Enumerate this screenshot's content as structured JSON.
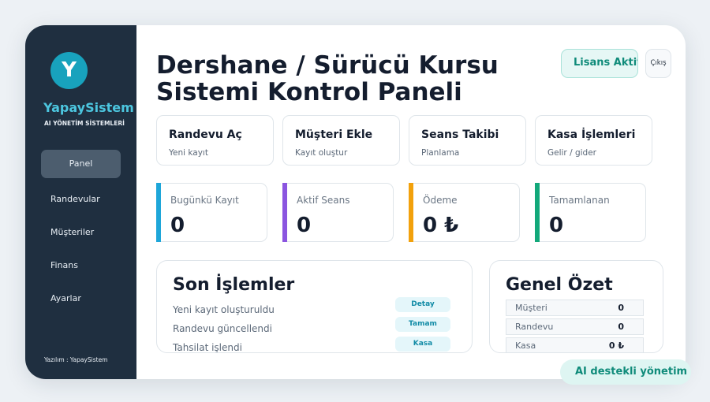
{
  "brand": {
    "logo_letter": "Y",
    "name": "YapaySistem",
    "subtitle": "AI YÖNETİM SİSTEMLERİ"
  },
  "sidebar": {
    "items": [
      {
        "label": "Panel",
        "active": true
      },
      {
        "label": "Randevular",
        "active": false
      },
      {
        "label": "Müşteriler",
        "active": false
      },
      {
        "label": "Finans",
        "active": false
      },
      {
        "label": "Ayarlar",
        "active": false
      }
    ],
    "footer": "Yazılım : YapaySistem"
  },
  "header": {
    "title_line1": "Dershane / Sürücü Kursu",
    "title_line2": "Sistemi Kontrol Paneli",
    "license_label": "Lisans Aktif",
    "logout_label": "Çıkış"
  },
  "quick_actions": [
    {
      "title": "Randevu Aç",
      "subtitle": "Yeni kayıt"
    },
    {
      "title": "Müşteri Ekle",
      "subtitle": "Kayıt oluştur"
    },
    {
      "title": "Seans Takibi",
      "subtitle": "Planlama"
    },
    {
      "title": "Kasa İşlemleri",
      "subtitle": "Gelir / gider"
    }
  ],
  "stats": [
    {
      "label": "Bugünkü Kayıt",
      "value": "0",
      "color": "#1ea6d9"
    },
    {
      "label": "Aktif Seans",
      "value": "0",
      "color": "#8b55e0"
    },
    {
      "label": "Ödeme",
      "value": "0 ₺",
      "color": "#f2a10c"
    },
    {
      "label": "Tamamlanan",
      "value": "0",
      "color": "#12a87a"
    }
  ],
  "recent": {
    "title": "Son İşlemler",
    "items": [
      {
        "text": "Yeni kayıt oluşturuldu",
        "badge": "Detay"
      },
      {
        "text": "Randevu güncellendi",
        "badge": "Tamam"
      },
      {
        "text": "Tahsilat işlendi",
        "badge": "Kasa"
      }
    ]
  },
  "summary": {
    "title": "Genel Özet",
    "rows": [
      {
        "label": "Müşteri",
        "value": "0"
      },
      {
        "label": "Randevu",
        "value": "0"
      },
      {
        "label": "Kasa",
        "value": "0 ₺"
      }
    ]
  },
  "footer_badge": "AI destekli yönetim",
  "colors": {
    "sidebar_bg": "#1f2f40",
    "accent_cyan": "#18a2bd",
    "accent_teal": "#0f8b7a"
  }
}
